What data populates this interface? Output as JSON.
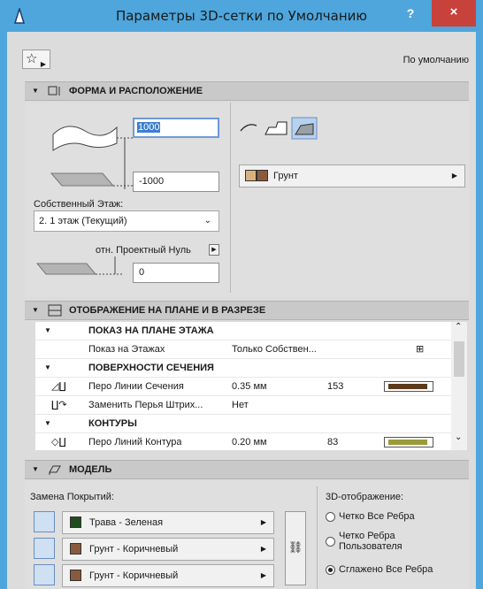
{
  "window": {
    "title": "Параметры 3D-сетки по Умолчанию",
    "help": "?",
    "close": "×"
  },
  "toolbar": {
    "default_label": "По умолчанию"
  },
  "sections": {
    "shape": "ФОРМА И РАСПОЛОЖЕНИЕ",
    "display": "ОТОБРАЖЕНИЕ НА ПЛАНЕ И В РАЗРЕЗЕ",
    "model": "МОДЕЛЬ"
  },
  "shape": {
    "top_value": "1000",
    "bottom_value": "-1000",
    "story_label": "Собственный Этаж:",
    "story_value": "2. 1 этаж (Текущий)",
    "reference_label": "отн. Проектный Нуль",
    "reference_value": "0",
    "material": "Грунт"
  },
  "table": {
    "rows": [
      {
        "group": true,
        "name": "ПОКАЗ НА ПЛАНЕ ЭТАЖА"
      },
      {
        "group": false,
        "name": "Показ на Этажах",
        "value": "Только Собствен...",
        "num": ""
      },
      {
        "group": true,
        "name": "ПОВЕРХНОСТИ СЕЧЕНИЯ"
      },
      {
        "group": false,
        "name": "Перо Линии Сечения",
        "value": "0.35 мм",
        "num": "153"
      },
      {
        "group": false,
        "name": "Заменить Перья Штрих...",
        "value": "Нет",
        "num": ""
      },
      {
        "group": true,
        "name": "КОНТУРЫ"
      },
      {
        "group": false,
        "name": "Перо Линий Контура",
        "value": "0.20 мм",
        "num": "83"
      }
    ]
  },
  "model": {
    "override_label": "Замена Покрытий:",
    "surfaces": [
      {
        "name": "Трава - Зеленая",
        "color": "#1f4d1f"
      },
      {
        "name": "Грунт - Коричневый",
        "color": "#8a5a3c"
      },
      {
        "name": "Грунт - Коричневый",
        "color": "#8a5a3c"
      }
    ],
    "display_label": "3D-отображение:",
    "options": [
      {
        "label": "Четко Все Ребра",
        "selected": false
      },
      {
        "label": "Четко Ребра Пользователя",
        "selected": false
      },
      {
        "label": "Сглажено Все Ребра",
        "selected": true
      }
    ]
  }
}
